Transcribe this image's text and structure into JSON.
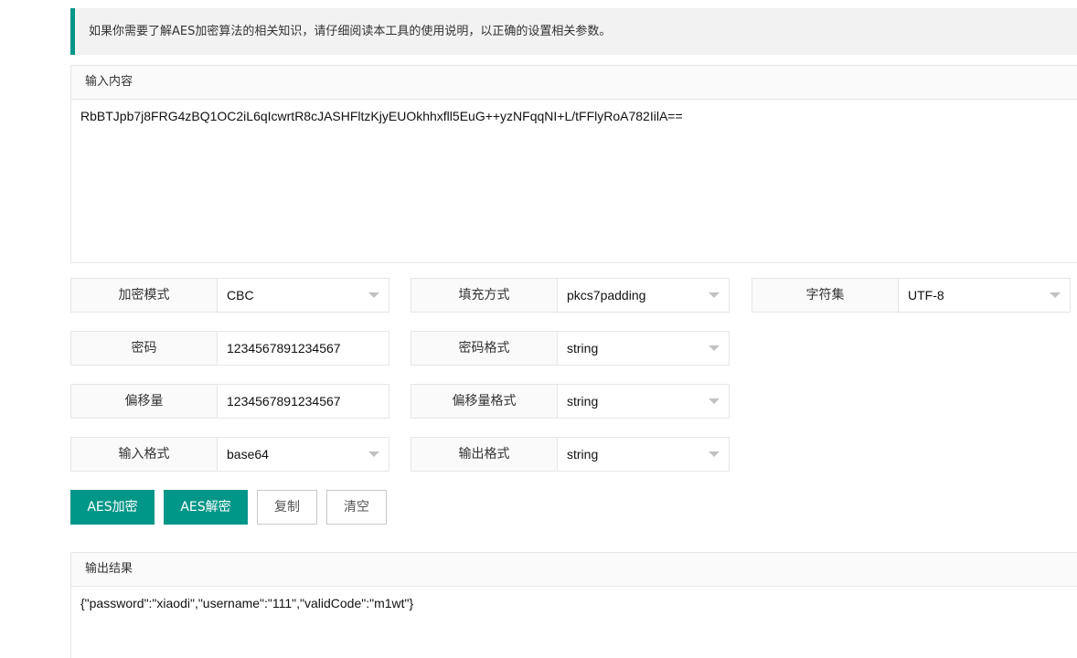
{
  "tip": "如果你需要了解AES加密算法的相关知识，请仔细阅读本工具的使用说明，以正确的设置相关参数。",
  "input": {
    "title": "输入内容",
    "value": "RbBTJpb7j8FRG4zBQ1OC2iL6qIcwrtR8cJASHFltzKjyEUOkhhxfll5EuG++yzNFqqNI+L/tFFlyRoA782IilA=="
  },
  "fields": {
    "mode": {
      "label": "加密模式",
      "value": "CBC"
    },
    "padding": {
      "label": "填充方式",
      "value": "pkcs7padding"
    },
    "charset": {
      "label": "字符集",
      "value": "UTF-8"
    },
    "password": {
      "label": "密码",
      "value": "1234567891234567"
    },
    "password_format": {
      "label": "密码格式",
      "value": "string"
    },
    "iv": {
      "label": "偏移量",
      "value": "1234567891234567"
    },
    "iv_format": {
      "label": "偏移量格式",
      "value": "string"
    },
    "input_format": {
      "label": "输入格式",
      "value": "base64"
    },
    "output_format": {
      "label": "输出格式",
      "value": "string"
    }
  },
  "buttons": {
    "encrypt": "AES加密",
    "decrypt": "AES解密",
    "copy": "复制",
    "clear": "清空"
  },
  "output": {
    "title": "输出结果",
    "value": "{\"password\":\"xiaodi\",\"username\":\"111\",\"validCode\":\"m1wt\"}"
  },
  "icons": {
    "dropdown": "chevron-down-icon"
  },
  "colors": {
    "accent": "#009688"
  }
}
